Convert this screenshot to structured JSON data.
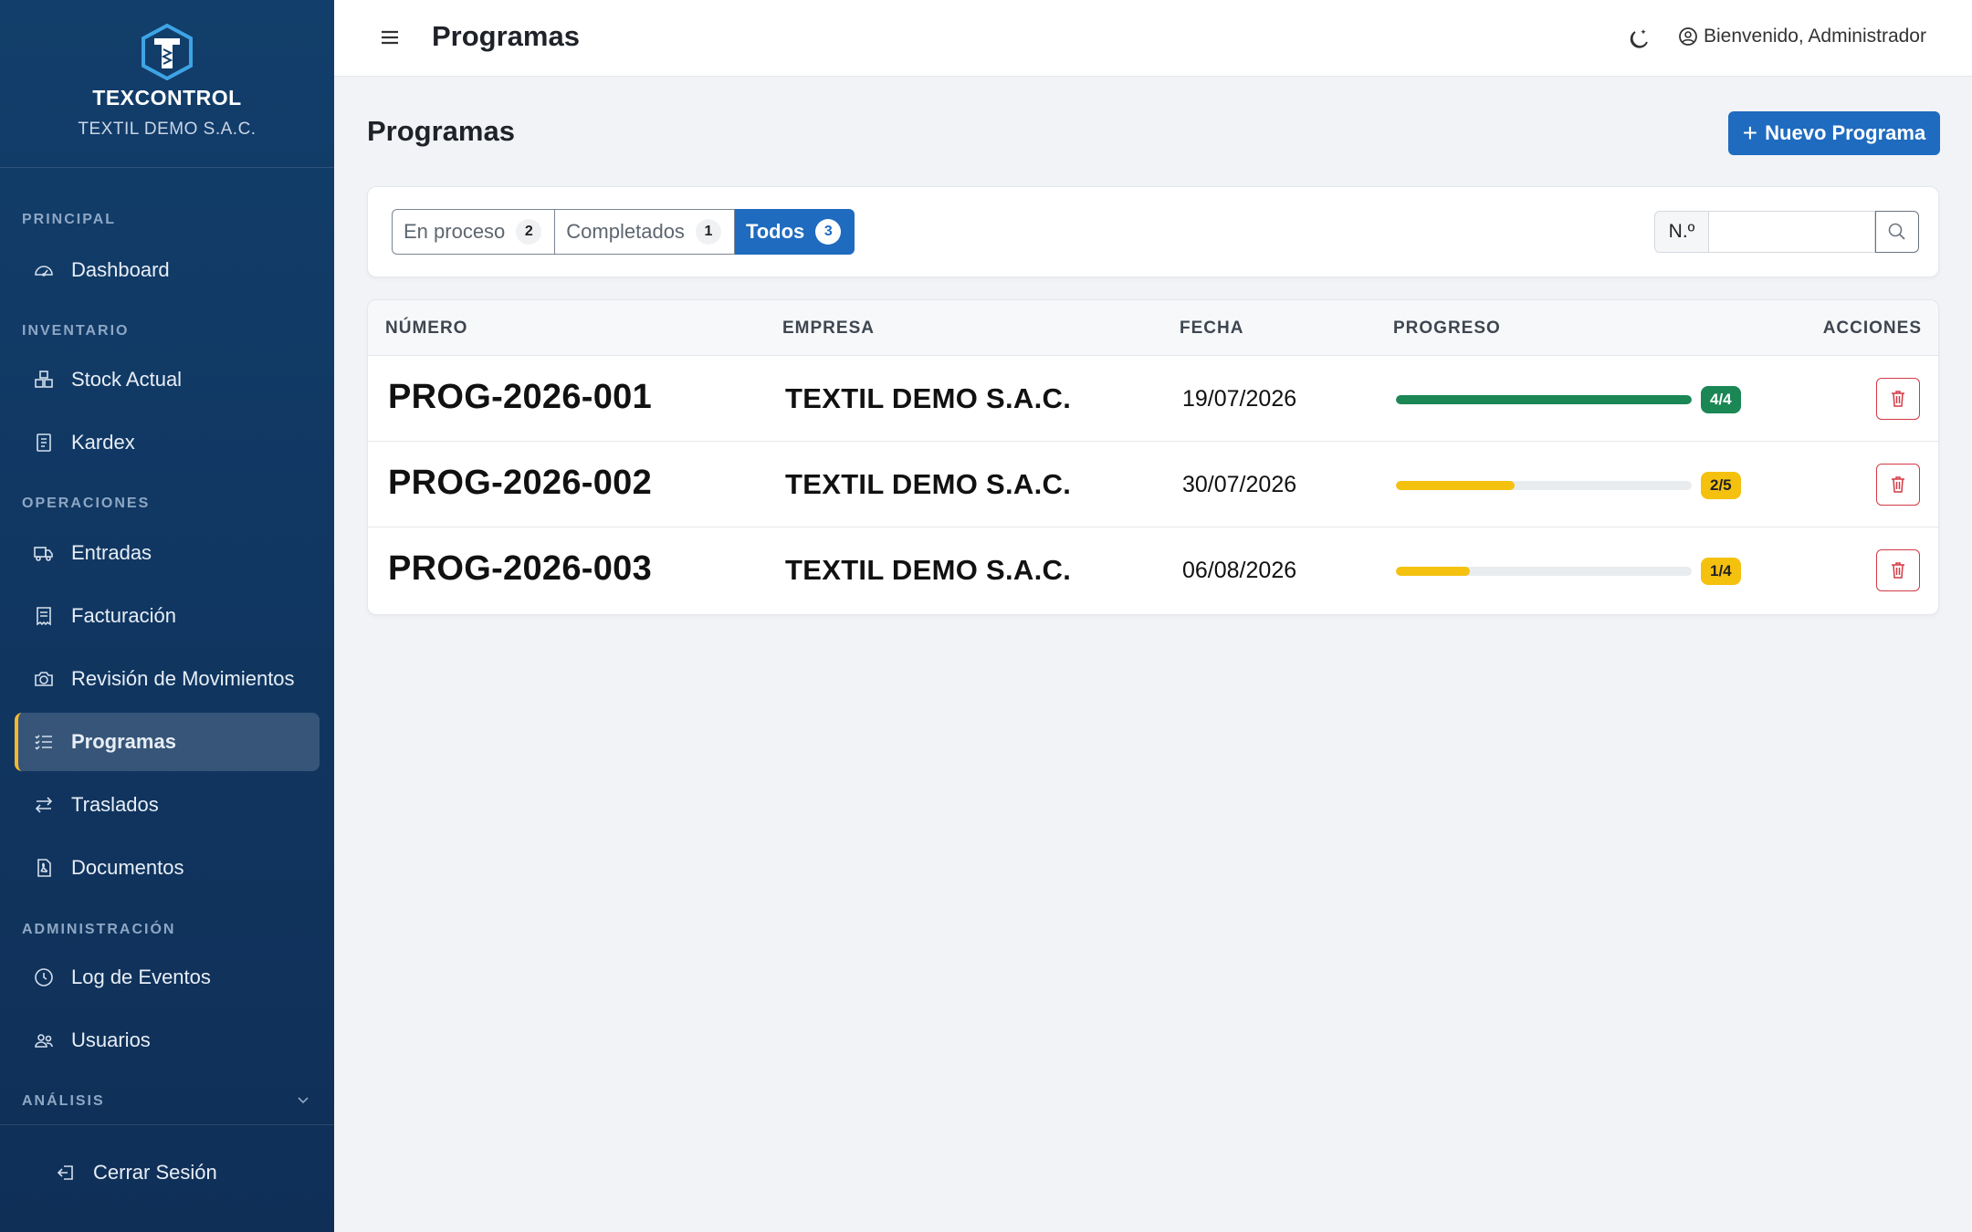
{
  "brand": {
    "name": "TEXCONTROL",
    "company": "TEXTIL DEMO S.A.C."
  },
  "sidebar": {
    "sections": {
      "principal": "PRINCIPAL",
      "inventario": "INVENTARIO",
      "operaciones": "OPERACIONES",
      "administracion": "ADMINISTRACIÓN",
      "analisis": "ANÁLISIS"
    },
    "items": {
      "dashboard": "Dashboard",
      "stock": "Stock Actual",
      "kardex": "Kardex",
      "entradas": "Entradas",
      "facturacion": "Facturación",
      "revision": "Revisión de Movimientos",
      "programas": "Programas",
      "traslados": "Traslados",
      "documentos": "Documentos",
      "log": "Log de Eventos",
      "usuarios": "Usuarios"
    },
    "logout": "Cerrar Sesión"
  },
  "topbar": {
    "title": "Programas",
    "user": "Bienvenido, Administrador"
  },
  "page": {
    "title": "Programas",
    "new_button": "Nuevo Programa"
  },
  "filters": {
    "tabs": [
      {
        "label": "En proceso",
        "count": "2"
      },
      {
        "label": "Completados",
        "count": "1"
      },
      {
        "label": "Todos",
        "count": "3"
      }
    ],
    "search_label": "N.º",
    "search_value": ""
  },
  "table": {
    "headers": {
      "numero": "NÚMERO",
      "empresa": "EMPRESA",
      "fecha": "FECHA",
      "progreso": "PROGRESO",
      "acciones": "ACCIONES"
    },
    "rows": [
      {
        "numero": "PROG-2026-001",
        "empresa": "TEXTIL DEMO S.A.C.",
        "fecha": "19/07/2026",
        "progress_label": "4/4",
        "progress": 1.0,
        "status_color": "#1a8754"
      },
      {
        "numero": "PROG-2026-002",
        "empresa": "TEXTIL DEMO S.A.C.",
        "fecha": "30/07/2026",
        "progress_label": "2/5",
        "progress": 0.4,
        "status_color": "#f5c10f"
      },
      {
        "numero": "PROG-2026-003",
        "empresa": "TEXTIL DEMO S.A.C.",
        "fecha": "06/08/2026",
        "progress_label": "1/4",
        "progress": 0.25,
        "status_color": "#f5c10f"
      }
    ]
  },
  "colors": {
    "primary": "#1f6bbf",
    "sidebar": "#123e6b",
    "accent": "#f5b82e",
    "danger": "#d33a45"
  },
  "icons": {
    "dashboard": "gauge-icon",
    "stock": "boxes-icon",
    "kardex": "journal-icon",
    "entradas": "truck-icon",
    "facturacion": "receipt-icon",
    "revision": "camera-icon",
    "programas": "list-check-icon",
    "traslados": "arrows-exchange-icon",
    "documentos": "file-pdf-icon",
    "log": "clock-icon",
    "usuarios": "people-icon",
    "logout": "box-arrow-left-icon"
  }
}
